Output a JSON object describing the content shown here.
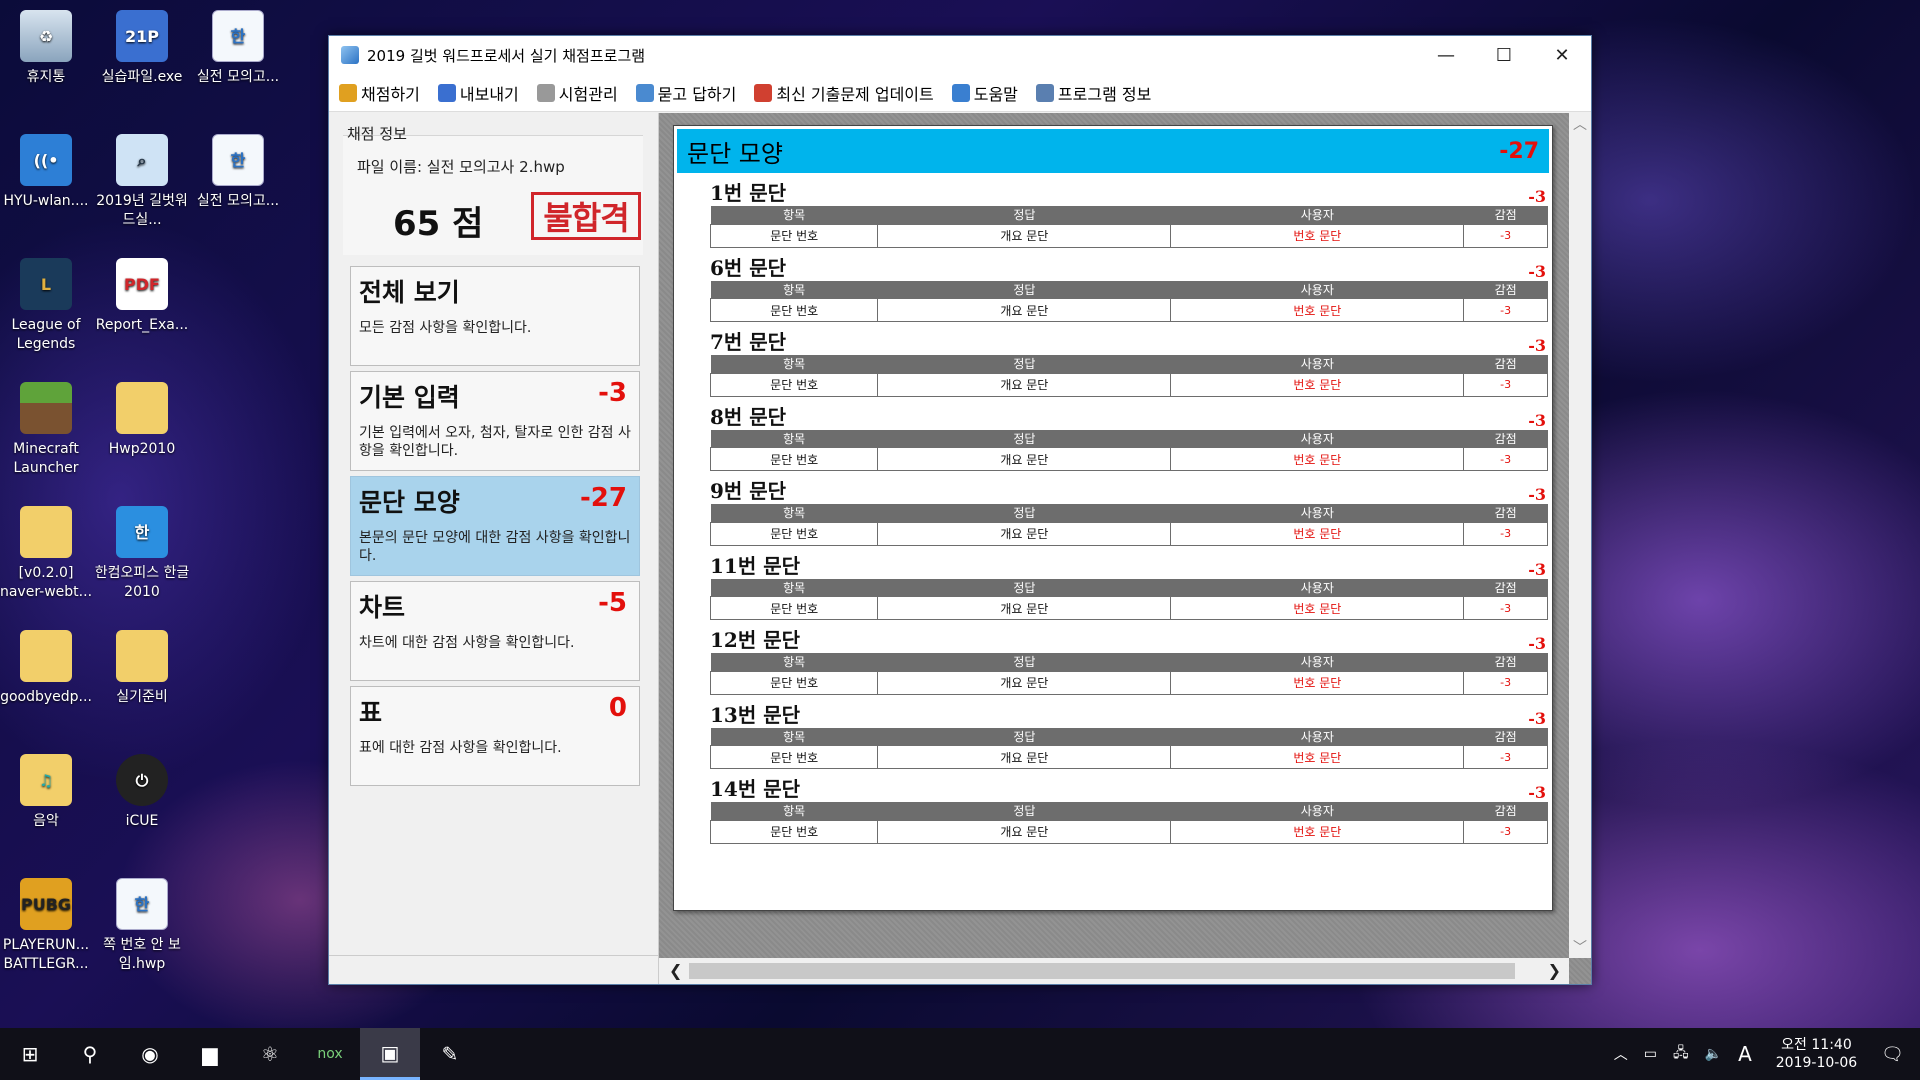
{
  "desktop_icons": [
    {
      "label": "휴지통",
      "icon": "recycle-bin-icon"
    },
    {
      "label": "실습파일.exe",
      "icon": "archive-icon"
    },
    {
      "label": "실전 모의고...",
      "icon": "hwp-doc-icon"
    },
    {
      "label": "HYU-wlan....",
      "icon": "wifi-icon"
    },
    {
      "label": "2019년 길벗워드실...",
      "icon": "magnifier-icon"
    },
    {
      "label": "실전 모의고...",
      "icon": "hwp-doc-icon"
    },
    {
      "label": "League of Legends",
      "icon": "lol-icon"
    },
    {
      "label": "Report_Exa...",
      "icon": "pdf-icon"
    },
    {
      "label": "Minecraft Launcher",
      "icon": "minecraft-icon"
    },
    {
      "label": "Hwp2010",
      "icon": "folder-icon"
    },
    {
      "label": "[v0.2.0] naver-webt...",
      "icon": "folder-icon"
    },
    {
      "label": "한컴오피스 한글 2010",
      "icon": "hancom-icon"
    },
    {
      "label": "goodbyedp...",
      "icon": "folder-icon"
    },
    {
      "label": "실기준비",
      "icon": "folder-icon"
    },
    {
      "label": "음악",
      "icon": "music-folder-icon"
    },
    {
      "label": "iCUE",
      "icon": "icue-icon"
    },
    {
      "label": "PLAYERUN... BATTLEGR...",
      "icon": "pubg-icon"
    },
    {
      "label": "쪽 번호 안 보임.hwp",
      "icon": "hwp-doc-icon"
    }
  ],
  "window": {
    "title": "2019 길벗 워드프로세서 실기 채점프로그램",
    "minimize": "—",
    "maximize": "☐",
    "close": "✕"
  },
  "menu": [
    {
      "label": "채점하기",
      "icon": "pencil-icon",
      "color": "#e0a020"
    },
    {
      "label": "내보내기",
      "icon": "save-icon",
      "color": "#3a6fd0"
    },
    {
      "label": "시험관리",
      "icon": "refresh-icon",
      "color": "#999999"
    },
    {
      "label": "묻고 답하기",
      "icon": "people-icon",
      "color": "#4a8ad0"
    },
    {
      "label": "최신 기출문제 업데이트",
      "icon": "gift-icon",
      "color": "#d04030"
    },
    {
      "label": "도움말",
      "icon": "help-icon",
      "color": "#3a7fd0"
    },
    {
      "label": "프로그램 정보",
      "icon": "info-icon",
      "color": "#5a7fb0"
    }
  ],
  "grading": {
    "group_title": "채점 정보",
    "file_name": "파일 이름: 실전 모의고사 2.hwp",
    "score": "65 점",
    "result": "불합격"
  },
  "categories": [
    {
      "title": "전체 보기",
      "score": "",
      "desc": "모든 감점 사항을 확인합니다."
    },
    {
      "title": "기본 입력",
      "score": "-3",
      "desc": "기본 입력에서 오자, 첨자, 탈자로 인한 감점 사항을 확인합니다."
    },
    {
      "title": "문단 모양",
      "score": "-27",
      "desc": "본문의 문단 모양에 대한 감점 사항을 확인합니다."
    },
    {
      "title": "차트",
      "score": "-5",
      "desc": "차트에 대한 감점 사항을 확인합니다."
    },
    {
      "title": "표",
      "score": "0",
      "desc": "표에 대한 감점 사항을 확인합니다."
    }
  ],
  "detail": {
    "title": "문단 모양",
    "points": "-27",
    "columns": [
      "항목",
      "정답",
      "사용자",
      "감점"
    ],
    "paragraphs": [
      {
        "name": "1번 문단",
        "points": "-3",
        "item": "문단 번호",
        "answer": "개요 문단",
        "user": "번호 문단",
        "deduct": "-3"
      },
      {
        "name": "6번 문단",
        "points": "-3",
        "item": "문단 번호",
        "answer": "개요 문단",
        "user": "번호 문단",
        "deduct": "-3"
      },
      {
        "name": "7번 문단",
        "points": "-3",
        "item": "문단 번호",
        "answer": "개요 문단",
        "user": "번호 문단",
        "deduct": "-3"
      },
      {
        "name": "8번 문단",
        "points": "-3",
        "item": "문단 번호",
        "answer": "개요 문단",
        "user": "번호 문단",
        "deduct": "-3"
      },
      {
        "name": "9번 문단",
        "points": "-3",
        "item": "문단 번호",
        "answer": "개요 문단",
        "user": "번호 문단",
        "deduct": "-3"
      },
      {
        "name": "11번 문단",
        "points": "-3",
        "item": "문단 번호",
        "answer": "개요 문단",
        "user": "번호 문단",
        "deduct": "-3"
      },
      {
        "name": "12번 문단",
        "points": "-3",
        "item": "문단 번호",
        "answer": "개요 문단",
        "user": "번호 문단",
        "deduct": "-3"
      },
      {
        "name": "13번 문단",
        "points": "-3",
        "item": "문단 번호",
        "answer": "개요 문단",
        "user": "번호 문단",
        "deduct": "-3"
      },
      {
        "name": "14번 문단",
        "points": "-3",
        "item": "문단 번호",
        "answer": "개요 문단",
        "user": "번호 문단",
        "deduct": "-3"
      }
    ]
  },
  "taskbar": {
    "apps": [
      {
        "name": "start-button",
        "glyph": "⊞"
      },
      {
        "name": "search-button",
        "glyph": "⚲"
      },
      {
        "name": "chrome-app",
        "glyph": "◉"
      },
      {
        "name": "file-explorer-app",
        "glyph": "▆"
      },
      {
        "name": "electron-app",
        "glyph": "⚛"
      },
      {
        "name": "nox-app",
        "glyph": "nox"
      },
      {
        "name": "grading-app",
        "glyph": "▣",
        "active": true
      },
      {
        "name": "hancom-app",
        "glyph": "✎"
      }
    ],
    "ime": "A",
    "time": "오전 11:40",
    "date": "2019-10-06"
  }
}
